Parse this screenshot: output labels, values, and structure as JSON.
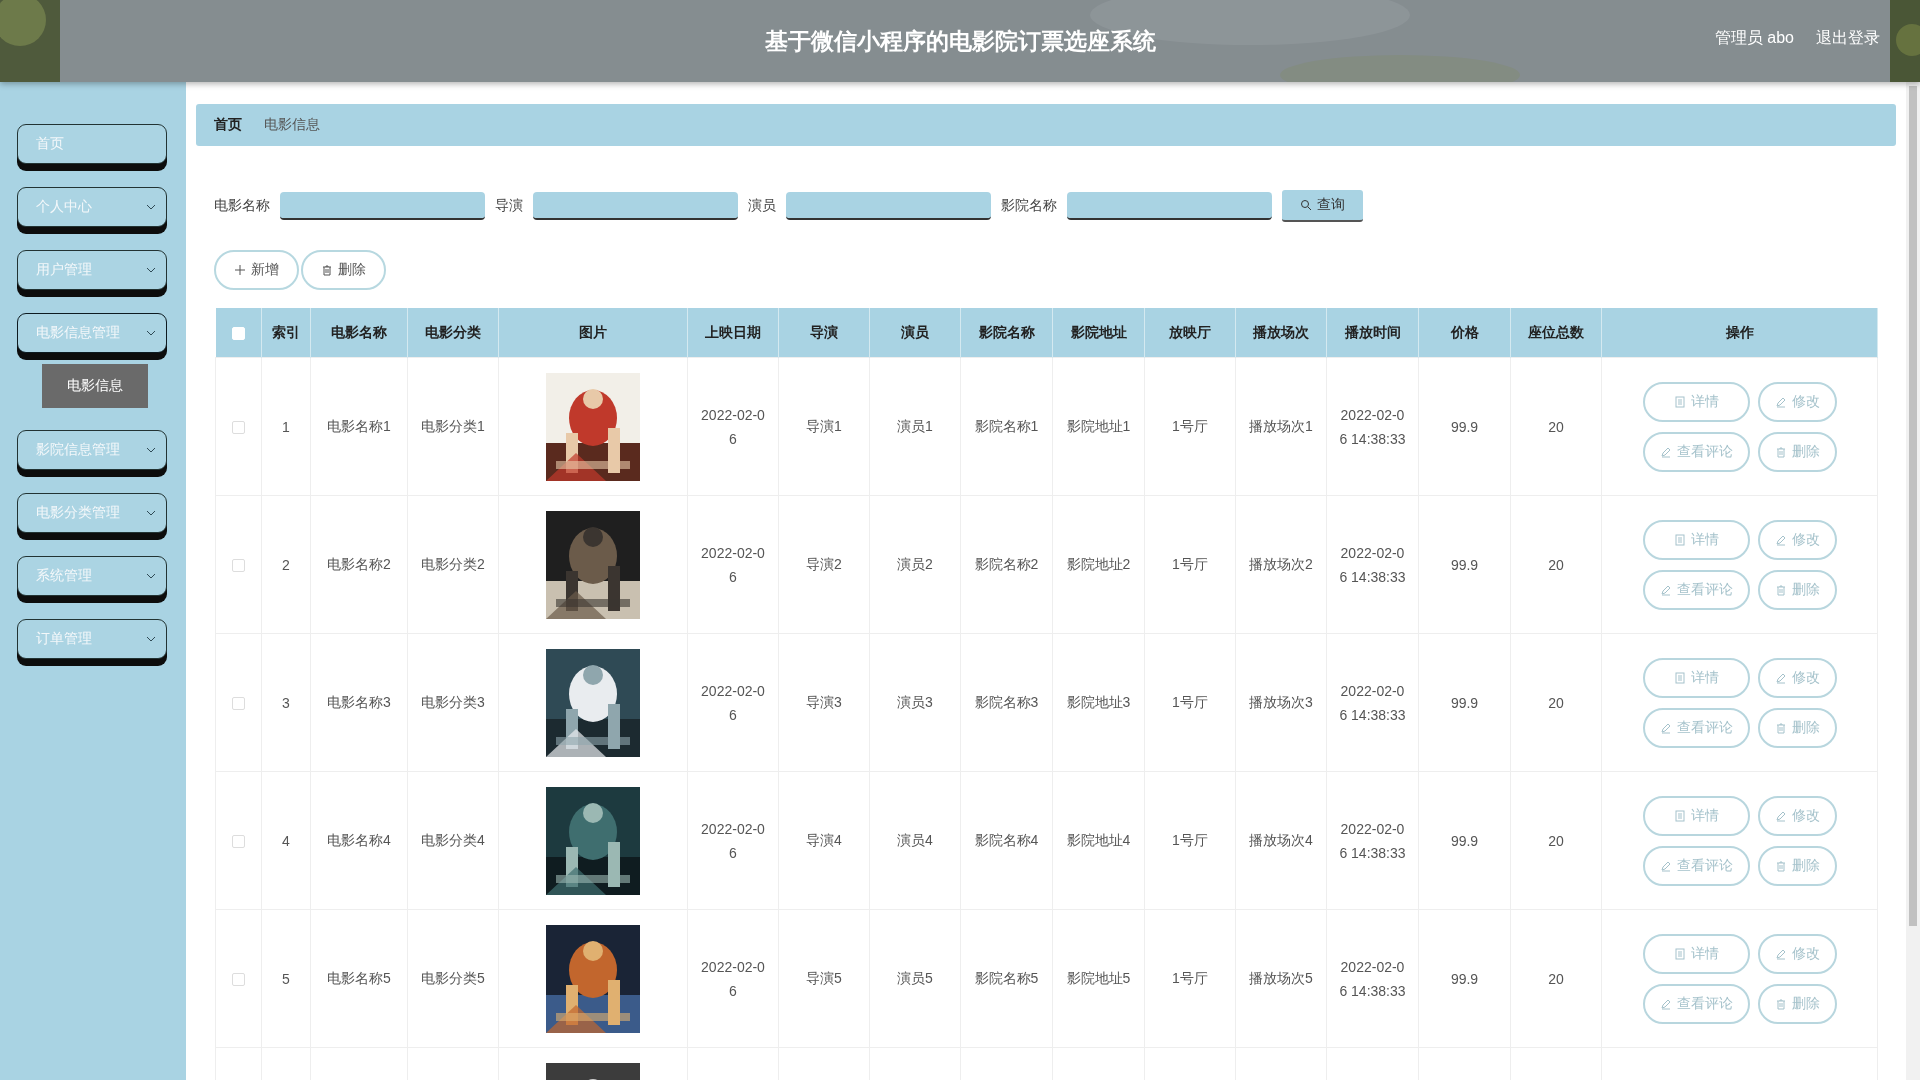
{
  "header": {
    "title": "基于微信小程序的电影院订票选座系统",
    "user": "管理员 abo",
    "logout": "退出登录"
  },
  "sidebar": {
    "items": [
      {
        "label": "首页",
        "kind": "link"
      },
      {
        "label": "个人中心",
        "kind": "menu",
        "expanded": false
      },
      {
        "label": "用户管理",
        "kind": "menu",
        "expanded": false
      },
      {
        "label": "电影信息管理",
        "kind": "menu",
        "expanded": true,
        "children": [
          {
            "label": "电影信息",
            "selected": true
          }
        ]
      },
      {
        "label": "影院信息管理",
        "kind": "menu",
        "expanded": false
      },
      {
        "label": "电影分类管理",
        "kind": "menu",
        "expanded": false
      },
      {
        "label": "系统管理",
        "kind": "menu",
        "expanded": false
      },
      {
        "label": "订单管理",
        "kind": "menu",
        "expanded": false
      }
    ]
  },
  "breadcrumb": [
    "首页",
    "电影信息"
  ],
  "search": {
    "fields": [
      {
        "label": "电影名称"
      },
      {
        "label": "导演"
      },
      {
        "label": "演员"
      },
      {
        "label": "影院名称"
      }
    ],
    "button": {
      "label": "查询",
      "kind": "search"
    }
  },
  "toolbar": [
    {
      "label": "新增",
      "kind": "add"
    },
    {
      "label": "删除",
      "kind": "delete"
    }
  ],
  "table": {
    "select_all": {
      "checked": false
    },
    "columns": [
      "索引",
      "电影名称",
      "电影分类",
      "图片",
      "上映日期",
      "导演",
      "演员",
      "影院名称",
      "影院地址",
      "放映厅",
      "播放场次",
      "播放时间",
      "价格",
      "座位总数",
      "操作"
    ],
    "rows": [
      {
        "checked": false,
        "index": "1",
        "name": "电影名称1",
        "category": "电影分类1",
        "image": {
          "kind": "picture"
        },
        "release": "2022-02-06",
        "director": "导演1",
        "actor": "演员1",
        "cinema": "影院名称1",
        "address": "影院地址1",
        "hall": "1号厅",
        "session": "播放场次1",
        "time": "2022-02-06 14:38:33",
        "price": "99.9",
        "seats": "20",
        "actions": [
          {
            "label": "详情",
            "kind": "detail"
          },
          {
            "label": "修改",
            "kind": "edit"
          },
          {
            "label": "查看评论",
            "kind": "comment"
          },
          {
            "label": "删除",
            "kind": "delete"
          }
        ]
      },
      {
        "checked": false,
        "index": "2",
        "name": "电影名称2",
        "category": "电影分类2",
        "image": {
          "kind": "picture"
        },
        "release": "2022-02-06",
        "director": "导演2",
        "actor": "演员2",
        "cinema": "影院名称2",
        "address": "影院地址2",
        "hall": "1号厅",
        "session": "播放场次2",
        "time": "2022-02-06 14:38:33",
        "price": "99.9",
        "seats": "20",
        "actions": [
          {
            "label": "详情",
            "kind": "detail"
          },
          {
            "label": "修改",
            "kind": "edit"
          },
          {
            "label": "查看评论",
            "kind": "comment"
          },
          {
            "label": "删除",
            "kind": "delete"
          }
        ]
      },
      {
        "checked": false,
        "index": "3",
        "name": "电影名称3",
        "category": "电影分类3",
        "image": {
          "kind": "picture"
        },
        "release": "2022-02-06",
        "director": "导演3",
        "actor": "演员3",
        "cinema": "影院名称3",
        "address": "影院地址3",
        "hall": "1号厅",
        "session": "播放场次3",
        "time": "2022-02-06 14:38:33",
        "price": "99.9",
        "seats": "20",
        "actions": [
          {
            "label": "详情",
            "kind": "detail"
          },
          {
            "label": "修改",
            "kind": "edit"
          },
          {
            "label": "查看评论",
            "kind": "comment"
          },
          {
            "label": "删除",
            "kind": "delete"
          }
        ]
      },
      {
        "checked": false,
        "index": "4",
        "name": "电影名称4",
        "category": "电影分类4",
        "image": {
          "kind": "picture"
        },
        "release": "2022-02-06",
        "director": "导演4",
        "actor": "演员4",
        "cinema": "影院名称4",
        "address": "影院地址4",
        "hall": "1号厅",
        "session": "播放场次4",
        "time": "2022-02-06 14:38:33",
        "price": "99.9",
        "seats": "20",
        "actions": [
          {
            "label": "详情",
            "kind": "detail"
          },
          {
            "label": "修改",
            "kind": "edit"
          },
          {
            "label": "查看评论",
            "kind": "comment"
          },
          {
            "label": "删除",
            "kind": "delete"
          }
        ]
      },
      {
        "checked": false,
        "index": "5",
        "name": "电影名称5",
        "category": "电影分类5",
        "image": {
          "kind": "picture"
        },
        "release": "2022-02-06",
        "director": "导演5",
        "actor": "演员5",
        "cinema": "影院名称5",
        "address": "影院地址5",
        "hall": "1号厅",
        "session": "播放场次5",
        "time": "2022-02-06 14:38:33",
        "price": "99.9",
        "seats": "20",
        "actions": [
          {
            "label": "详情",
            "kind": "detail"
          },
          {
            "label": "修改",
            "kind": "edit"
          },
          {
            "label": "查看评论",
            "kind": "comment"
          },
          {
            "label": "删除",
            "kind": "delete"
          }
        ]
      },
      {
        "image": {
          "kind": "picture"
        }
      }
    ]
  }
}
